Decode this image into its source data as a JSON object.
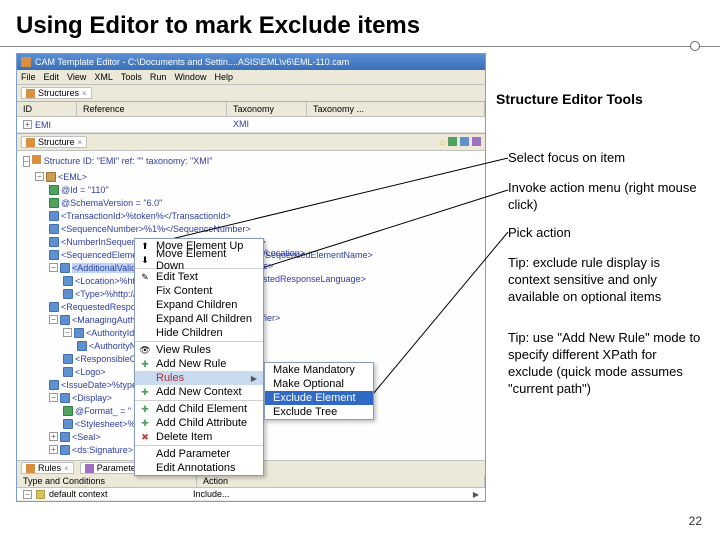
{
  "slide": {
    "title": "Using Editor to mark Exclude items",
    "page_number": "22"
  },
  "app": {
    "titlebar": "CAM Template Editor - C:\\Documents and Settin....ASIS\\EML\\v6\\EML-110.cam",
    "menu": [
      "File",
      "Edit",
      "View",
      "XML",
      "Tools",
      "Run",
      "Window",
      "Help"
    ],
    "structures_tab": "Structures",
    "grid_headers": [
      "ID",
      "Reference",
      "Taxonomy",
      "Taxonomy ..."
    ],
    "grid_row": {
      "id": "EMI",
      "taxonomy": "XMI"
    },
    "struct_tab_label": "Structure",
    "struct_root": "Structure ID: \"EMI\" ref: \"\" taxonomy: \"XMI\"",
    "tree": [
      "<EML>",
      "@Id = \"110\"",
      "@SchemaVersion = \"6.0\"",
      "<TransactionId>%token%</TransactionId>",
      "<SequenceNumber>%1%</SequenceNumber>",
      "<NumberInSequence>%1%</NumberInSequence>",
      "<SequencedElementName>%type=NMTOKEN%</SequencedElementName>",
      "<AdditionalValidati",
      "<Location>%http",
      "<Type>%http://",
      "<RequestedResponsi",
      "<ManagingAuthorit",
      "<AuthorityIdenti",
      "<AuthorityNa",
      "<ResponsibleOfff",
      "<Logo>",
      "<IssueDate>%type",
      "<Display>",
      "@Format_ = \" ...",
      "<Stylesheet>%",
      "<Seal>",
      "<ds:Signature>"
    ],
    "rules_tabs": [
      "Rules",
      "Parameters"
    ],
    "type_header": [
      "Type and Conditions",
      "Action"
    ],
    "default_context": "default context",
    "include_label": "Include..."
  },
  "context_menu": {
    "items": [
      "Move Element Up",
      "Move Element Down",
      "Edit Text",
      "Fix Content",
      "Expand Children",
      "Expand All Children",
      "Hide Children",
      "View Rules",
      "Add New Rule",
      "Rules",
      "Add New Context",
      "Add Child Element",
      "Add Child Attribute",
      "Delete Item",
      "Add Parameter",
      "Edit Annotations"
    ],
    "submenu": [
      "Make Mandatory",
      "Make Optional",
      "Exclude Element",
      "Exclude Tree"
    ]
  },
  "right_fragments": [
    "</Location>",
    "pe>",
    "estedResponseLanguage>",
    "tifier>"
  ],
  "annotations": {
    "heading": "Structure Editor Tools",
    "a1": "Select focus on item",
    "a2": "Invoke action menu (right mouse click)",
    "a3": "Pick action",
    "a4": "Tip: exclude rule display is context sensitive and only available on optional items",
    "a5": "Tip: use \"Add New Rule\" mode to specify different XPath for exclude (quick mode assumes \"current path\")"
  }
}
